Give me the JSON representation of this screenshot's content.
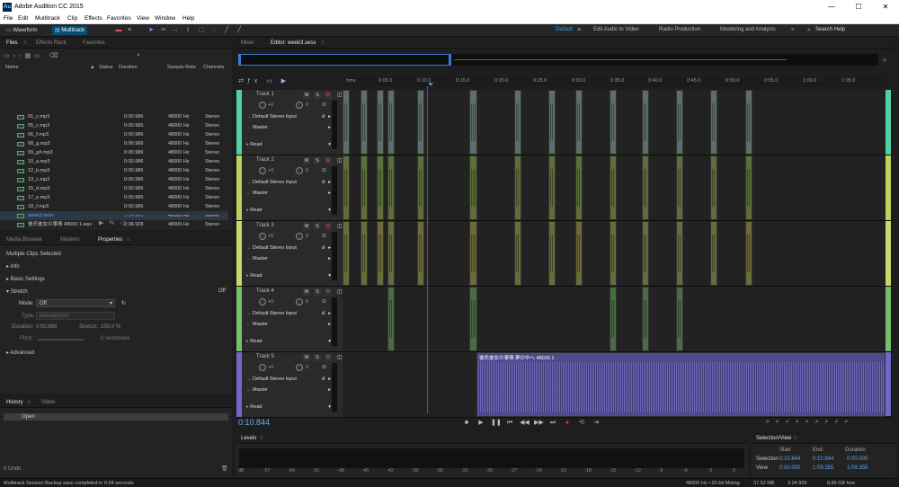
{
  "titlebar": {
    "title": "Adobe Audition CC 2015",
    "au": "Au",
    "min": "—",
    "max": "☐",
    "close": "✕"
  },
  "menu": [
    "File",
    "Edit",
    "Multitrack",
    "Clip",
    "Effects",
    "Favorites",
    "View",
    "Window",
    "Help"
  ],
  "toolbar": {
    "waveform": "Waveform",
    "multitrack": "Multitrack"
  },
  "workspaces": {
    "items": [
      "Default",
      "Edit Audio to Video",
      "Radio Production",
      "Mastering and Analysis"
    ],
    "active": "Default",
    "more": "»",
    "search": "Search Help"
  },
  "files_panel": {
    "tabs": [
      "Files",
      "Effects Rack",
      "Favorites"
    ],
    "headers": {
      "name": "Name",
      "status": "Status",
      "duration": "Duration",
      "rate": "Sample Rate",
      "channels": "Channels"
    },
    "rows": [
      {
        "name": "01_c.mp3",
        "dur": "0:00.986",
        "rate": "48000 Hz",
        "ch": "Stereo"
      },
      {
        "name": "05_c.mp3",
        "dur": "0:00.986",
        "rate": "48000 Hz",
        "ch": "Stereo"
      },
      {
        "name": "06_f.mp3",
        "dur": "0:00.986",
        "rate": "48000 Hz",
        "ch": "Stereo"
      },
      {
        "name": "08_g.mp3",
        "dur": "0:00.986",
        "rate": "48000 Hz",
        "ch": "Stereo"
      },
      {
        "name": "09_g#.mp3",
        "dur": "0:00.986",
        "rate": "48000 Hz",
        "ch": "Stereo"
      },
      {
        "name": "10_a.mp3",
        "dur": "0:00.986",
        "rate": "48000 Hz",
        "ch": "Stereo"
      },
      {
        "name": "12_b.mp3",
        "dur": "0:00.986",
        "rate": "48000 Hz",
        "ch": "Stereo"
      },
      {
        "name": "13_c.mp3",
        "dur": "0:00.986",
        "rate": "48000 Hz",
        "ch": "Stereo"
      },
      {
        "name": "15_d.mp3",
        "dur": "0:00.986",
        "rate": "48000 Hz",
        "ch": "Stereo"
      },
      {
        "name": "17_e.mp3",
        "dur": "0:00.986",
        "rate": "48000 Hz",
        "ch": "Stereo"
      },
      {
        "name": "18_f.mp3",
        "dur": "0:00.986",
        "rate": "48000 Hz",
        "ch": "Stereo"
      },
      {
        "name": "week3.sesx",
        "dur": "3:24.928",
        "rate": "48000 Hz",
        "ch": "Stereo",
        "selected": true
      },
      {
        "name": "彼氏彼女の事情 48000 1.wav",
        "dur": "2:38.928",
        "rate": "48000 Hz",
        "ch": "Stereo"
      }
    ]
  },
  "props_panel": {
    "tabs": [
      "Media Browser",
      "Markers",
      "Properties"
    ],
    "title": "Multiple Clips Selected",
    "sections": [
      "Info",
      "Basic Settings",
      "Stretch",
      "Advanced"
    ],
    "stretch_state": "Off",
    "mode_label": "Mode:",
    "mode_value": "Off",
    "type_label": "Type:",
    "type_value": "Monophonic",
    "duration_label": "Duration:",
    "duration_value": "0:00.986",
    "stretch_label": "Stretch:",
    "stretch_value": "100.0 %",
    "pitch_label": "Pitch:",
    "pitch_value": "0 semitones"
  },
  "history_panel": {
    "tabs": [
      "History",
      "Video"
    ],
    "item": "Open",
    "undo": "0 Undo"
  },
  "status_bar": {
    "message": "Multitrack Session Backup save completed in 0.04 seconds",
    "rate": "48000 Hz • 32-bit Mixing",
    "mem": "37.52 MB",
    "dur": "3:24.928",
    "free": "8.86 GB free"
  },
  "editor": {
    "tabs": [
      "Mixer",
      "Editor: week3.sesx"
    ],
    "ruler": [
      "hms",
      "0:05.0",
      "0:10.0",
      "0:15.0",
      "0:20.0",
      "0:25.0",
      "0:30.0",
      "0:35.0",
      "0:40.0",
      "0:45.0",
      "0:50.0",
      "0:55.0",
      "1:00.0",
      "1:05.0"
    ],
    "time": "0:10.844",
    "tracks": [
      {
        "name": "Track 1",
        "color": "#4fd1a3",
        "vol": "+0",
        "pan": "0",
        "input": "Default Stereo Input",
        "output": "Master",
        "auto": "Read",
        "clip": "#5c6e68"
      },
      {
        "name": "Track 2",
        "color": "#b9d35a",
        "vol": "+0",
        "pan": "0",
        "input": "Default Stereo Input",
        "output": "Master",
        "auto": "Read",
        "clip": "#5d6e3a"
      },
      {
        "name": "Track 3",
        "color": "#c8d66a",
        "vol": "+0",
        "pan": "0",
        "input": "Default Stereo Input",
        "output": "Master",
        "auto": "Read",
        "clip": "#6a6a3c"
      },
      {
        "name": "Track 4",
        "color": "#74c06a",
        "vol": "+0",
        "pan": "0",
        "input": "Default Stereo Input",
        "output": "Master",
        "auto": "Read",
        "clip": "#4b6a46"
      },
      {
        "name": "Track 5",
        "color": "#7067c8",
        "vol": "+0",
        "pan": "0",
        "input": "Default Stereo Input",
        "output": "Master",
        "auto": "Read",
        "clip": "#4f4a8a",
        "clip_name": "彼氏彼女の事情 夢の中へ 48000 1"
      }
    ],
    "msr": [
      "M",
      "S",
      "R"
    ]
  },
  "levels": {
    "title": "Levels",
    "scale": [
      "dB",
      "-57",
      "-54",
      "-51",
      "-48",
      "-45",
      "-42",
      "-39",
      "-36",
      "-33",
      "-30",
      "-27",
      "-24",
      "-21",
      "-18",
      "-15",
      "-12",
      "-9",
      "-6",
      "-3",
      "0"
    ]
  },
  "selection_view": {
    "title": "Selection/View",
    "headers": [
      "Start",
      "End",
      "Duration"
    ],
    "selection": {
      "label": "Selection",
      "start": "0:10.844",
      "end": "0:10.844",
      "dur": "0:00.000"
    },
    "view": {
      "label": "View",
      "start": "0:00.000",
      "end": "1:09.355",
      "dur": "1:09.355"
    }
  }
}
